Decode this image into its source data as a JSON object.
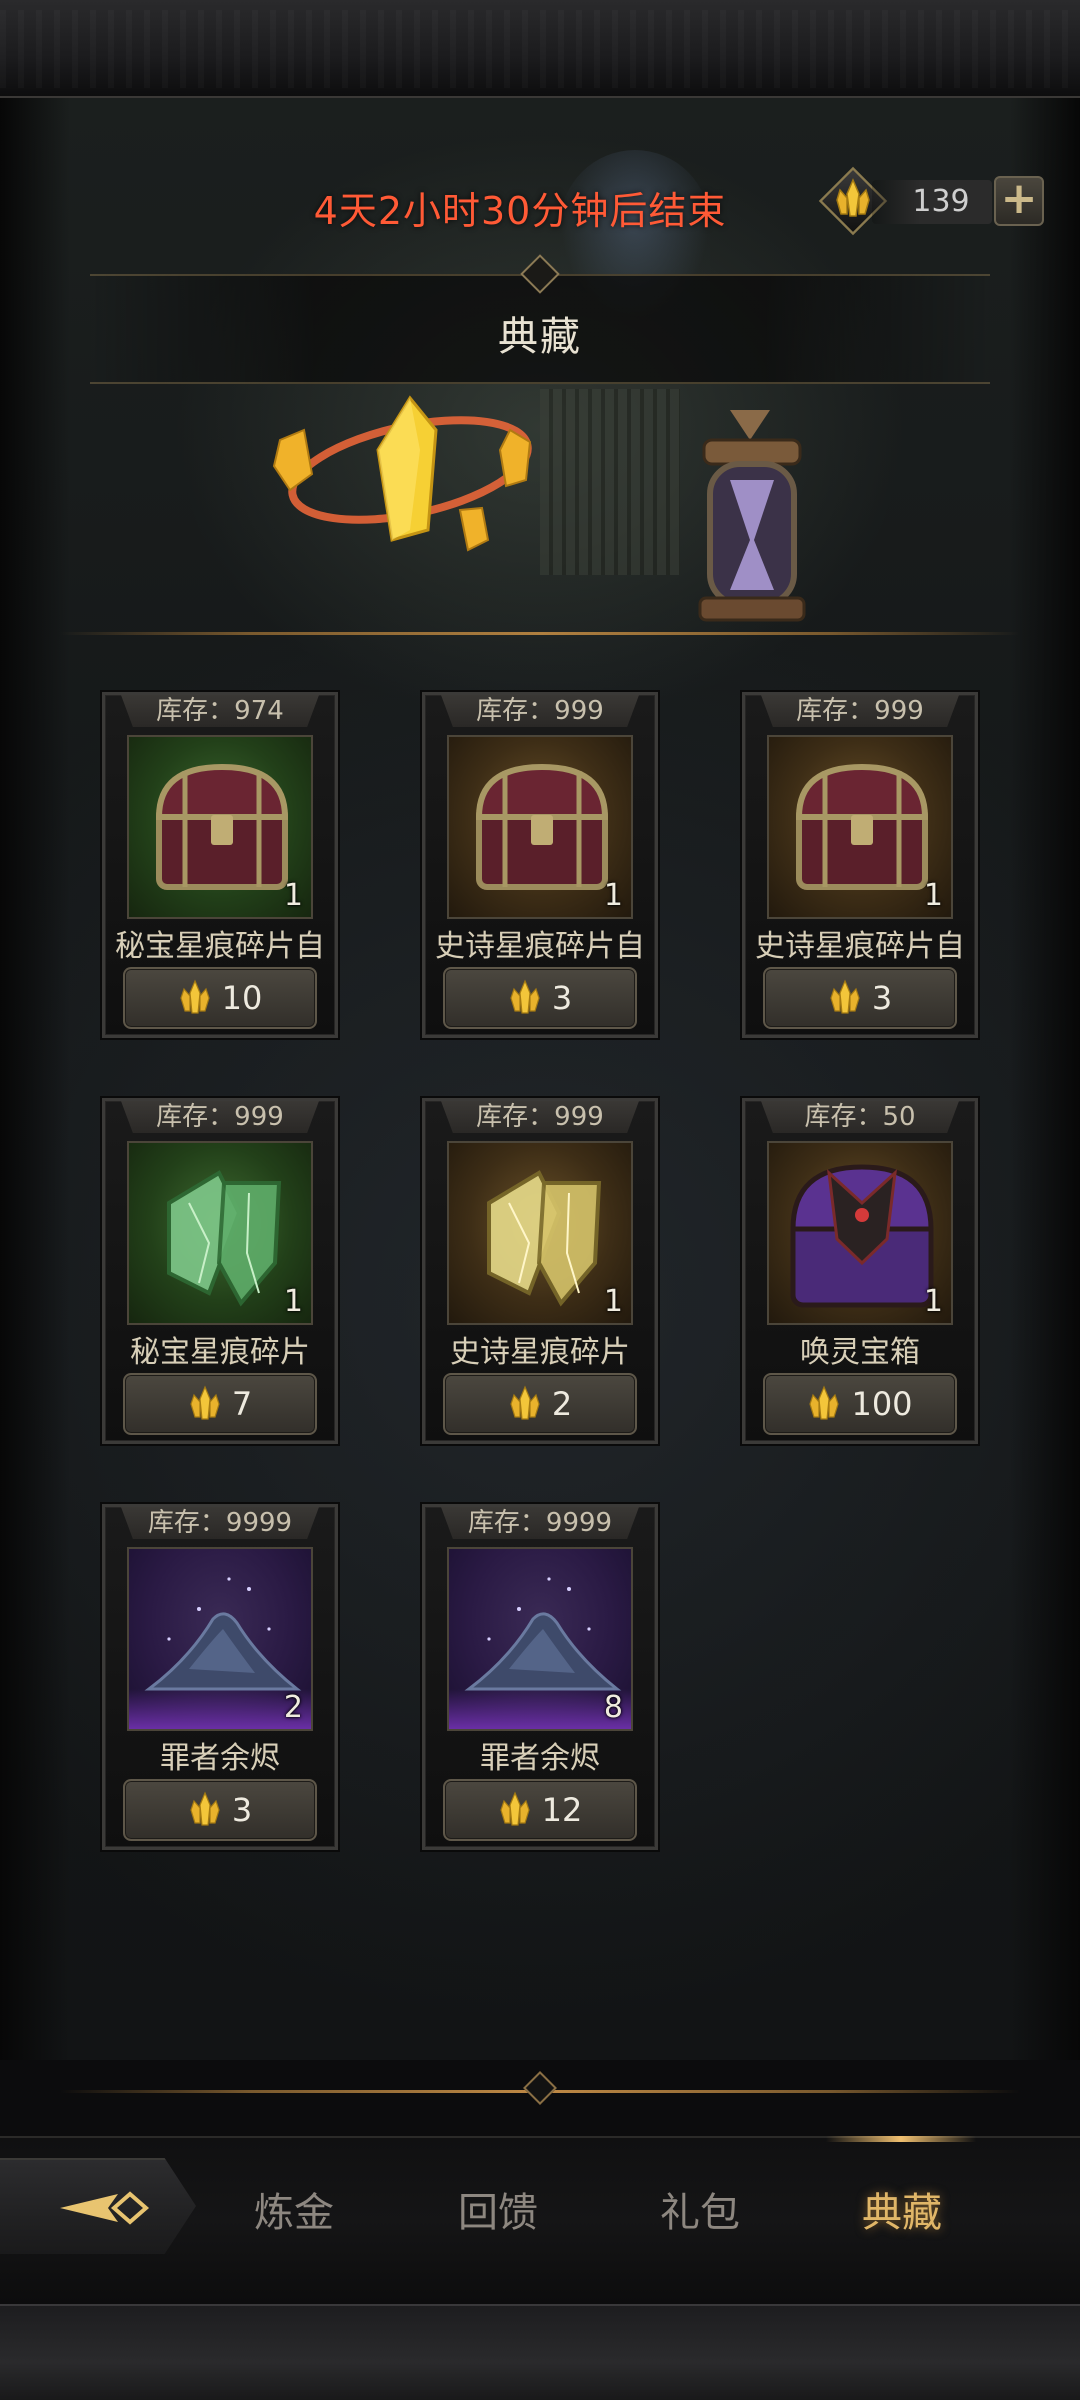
{
  "header": {
    "timer": "4天2小时30分钟后结束",
    "currency_amount": "139",
    "currency_icon": "gold-crystal-icon",
    "add_icon": "plus-icon",
    "title": "典藏"
  },
  "items": [
    {
      "stock": "库存：974",
      "name": "秘宝星痕碎片自",
      "qty": "1",
      "price": "10",
      "rarity": "green",
      "icon": "treasure-chest-icon"
    },
    {
      "stock": "库存：999",
      "name": "史诗星痕碎片自",
      "qty": "1",
      "price": "3",
      "rarity": "gold",
      "icon": "treasure-chest-icon"
    },
    {
      "stock": "库存：999",
      "name": "史诗星痕碎片自",
      "qty": "1",
      "price": "3",
      "rarity": "gold",
      "icon": "treasure-chest-icon"
    },
    {
      "stock": "库存：999",
      "name": "秘宝星痕碎片",
      "qty": "1",
      "price": "7",
      "rarity": "green",
      "icon": "green-crystal-shard-icon"
    },
    {
      "stock": "库存：999",
      "name": "史诗星痕碎片",
      "qty": "1",
      "price": "2",
      "rarity": "gold",
      "icon": "gold-crystal-shard-icon"
    },
    {
      "stock": "库存：50",
      "name": "唤灵宝箱",
      "qty": "1",
      "price": "100",
      "rarity": "gold",
      "icon": "purple-chest-icon"
    },
    {
      "stock": "库存：9999",
      "name": "罪者余烬",
      "qty": "2",
      "price": "3",
      "rarity": "purple",
      "icon": "ember-pile-icon"
    },
    {
      "stock": "库存：9999",
      "name": "罪者余烬",
      "qty": "8",
      "price": "12",
      "rarity": "purple",
      "icon": "ember-pile-icon"
    }
  ],
  "nav": {
    "back_icon": "back-arrow-icon",
    "tabs": [
      {
        "label": "炼金",
        "active": false
      },
      {
        "label": "回馈",
        "active": false
      },
      {
        "label": "礼包",
        "active": false
      },
      {
        "label": "典藏",
        "active": true
      }
    ]
  },
  "colors": {
    "timer": "#ff5a36",
    "active_tab": "#e0b668",
    "inactive_tab": "#8d8780",
    "rarity_green": "#2f5a24",
    "rarity_gold": "#4e3a1c",
    "rarity_purple": "#6a2fa6"
  }
}
